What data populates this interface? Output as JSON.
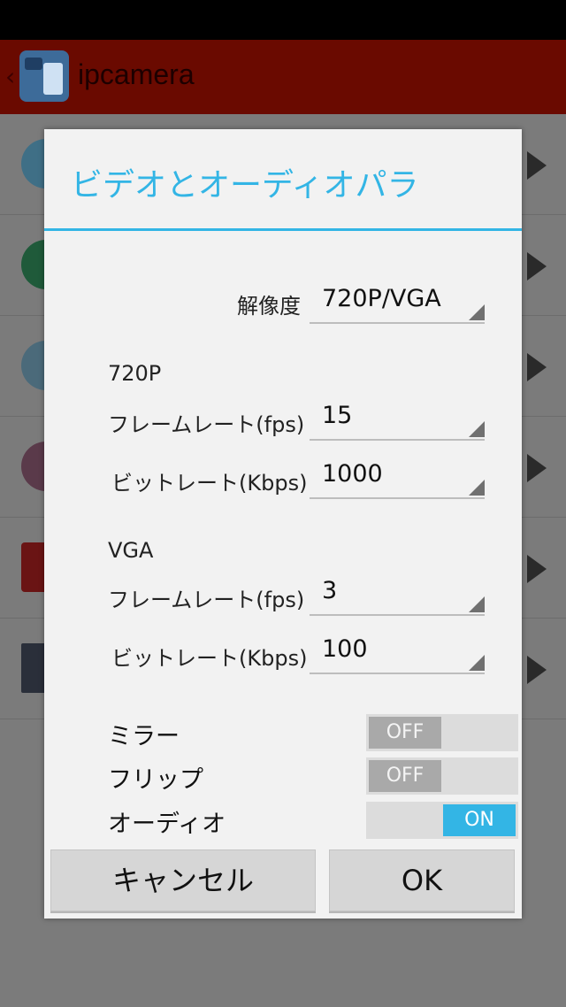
{
  "app_bar": {
    "title": "ipcamera",
    "back_icon": "chevron-left-icon",
    "app_icon": "ipcamera-app-icon",
    "color": "#6a0a00"
  },
  "dialog": {
    "title": "ビデオとオーディオパラ",
    "accent_color": "#33b5e5",
    "resolution": {
      "label": "解像度",
      "value": "720P/VGA"
    },
    "section_720p": {
      "heading": "720P",
      "framerate": {
        "label": "フレームレート(fps)",
        "value": "15"
      },
      "bitrate": {
        "label": "ビットレート(Kbps)",
        "value": "1000"
      }
    },
    "section_vga": {
      "heading": "VGA",
      "framerate": {
        "label": "フレームレート(fps)",
        "value": "3"
      },
      "bitrate": {
        "label": "ビットレート(Kbps)",
        "value": "100"
      }
    },
    "mirror": {
      "label": "ミラー",
      "state": "OFF"
    },
    "flip": {
      "label": "フリップ",
      "state": "OFF"
    },
    "audio": {
      "label": "オーディオ",
      "state": "ON"
    },
    "buttons": {
      "cancel": "キャンセル",
      "ok": "OK"
    }
  }
}
